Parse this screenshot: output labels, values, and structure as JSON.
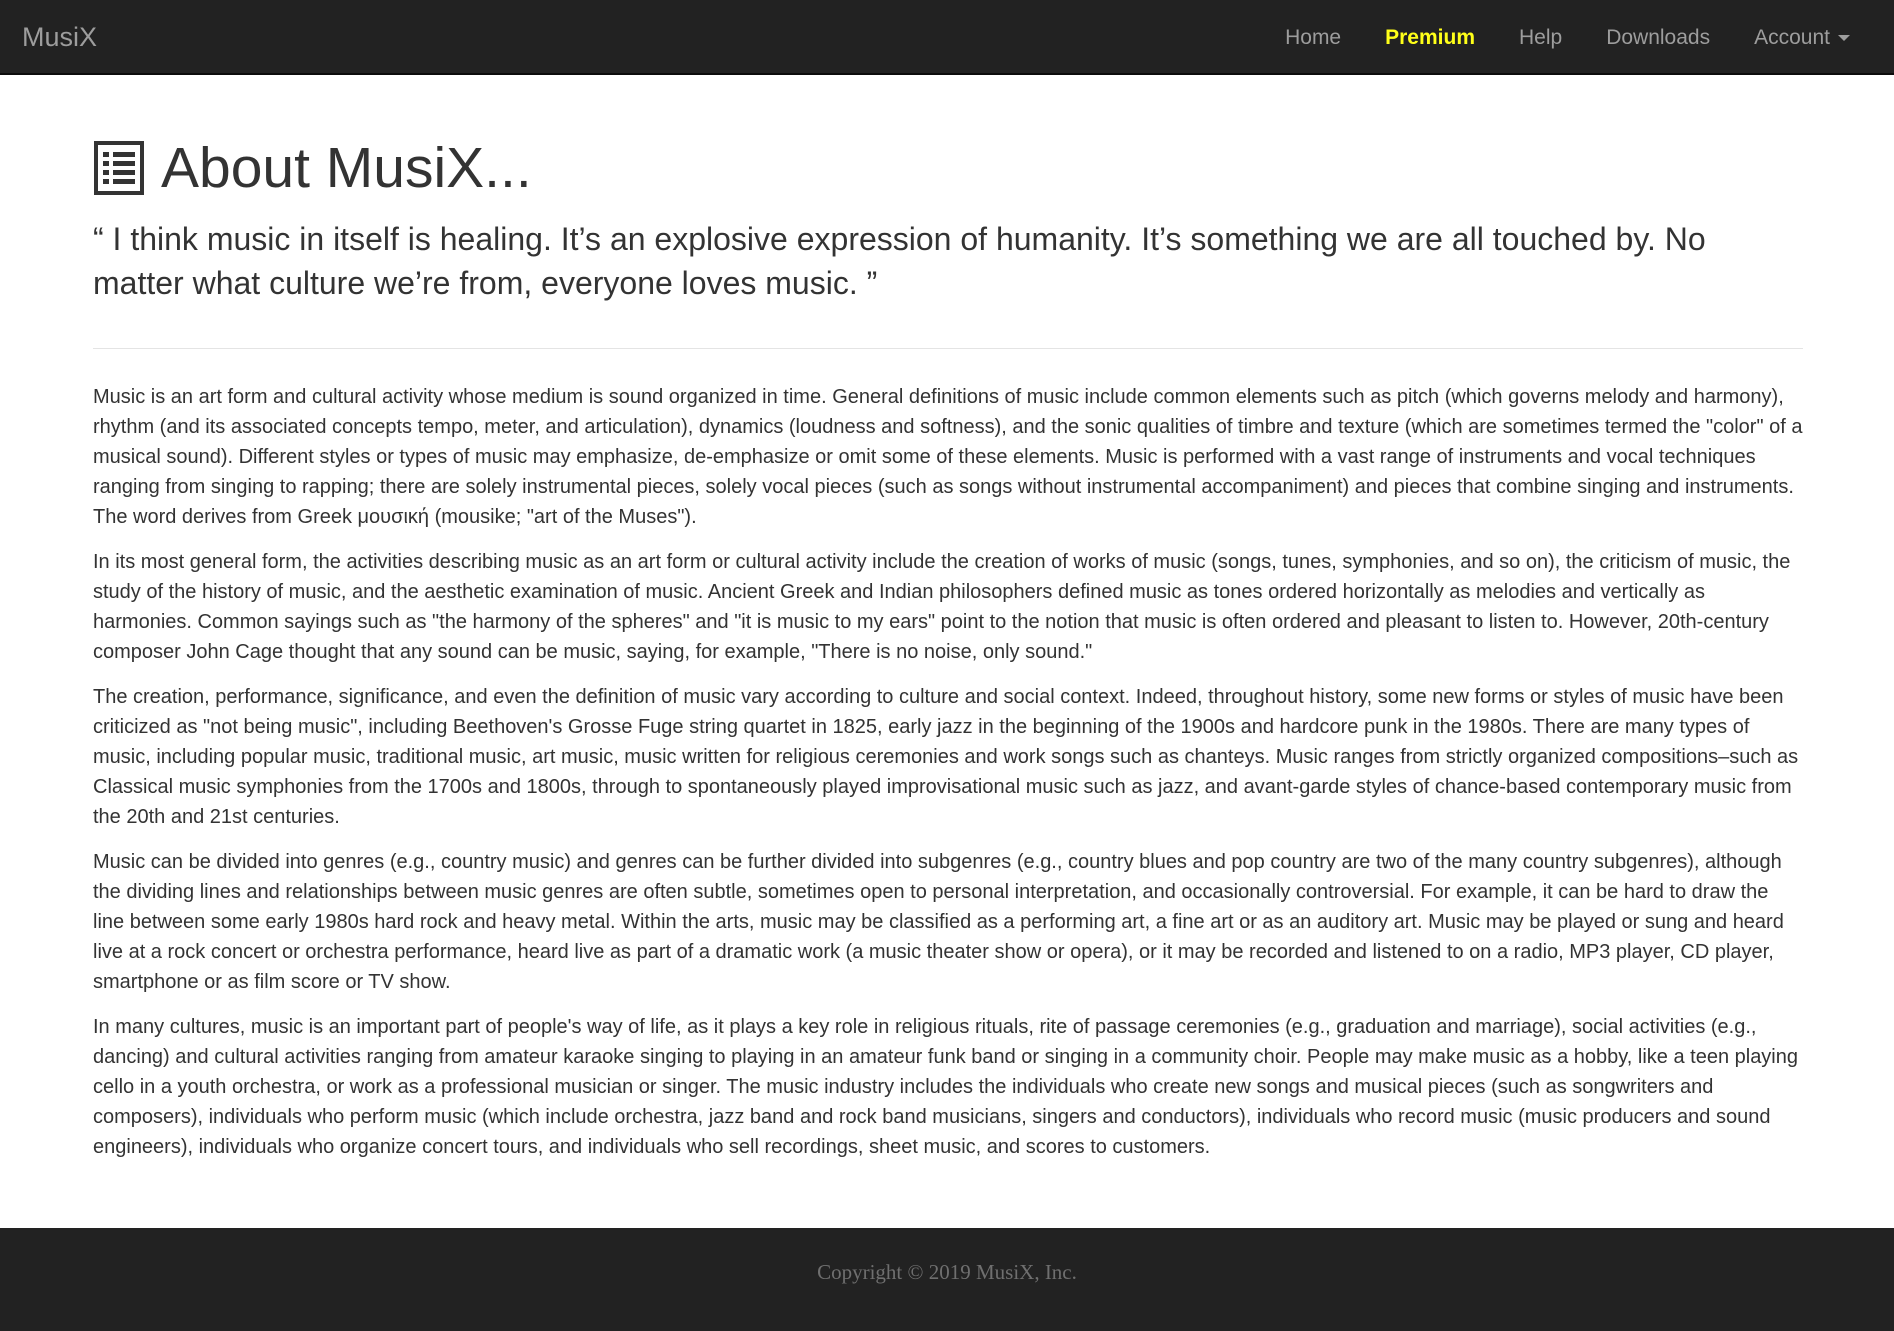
{
  "navbar": {
    "brand": "MusiX",
    "links": [
      {
        "label": "Home"
      },
      {
        "label": "Premium"
      },
      {
        "label": "Help"
      },
      {
        "label": "Downloads"
      },
      {
        "label": "Account"
      }
    ],
    "colors": {
      "background": "#222222",
      "link": "#9d9d9d",
      "premium": "#ffff19"
    }
  },
  "header": {
    "icon": "list-icon",
    "title": "About MusiX...",
    "quote": "“ I think music in itself is healing. It’s an explosive expression of humanity. It’s something we are all touched by. No matter what culture we’re from, everyone loves music. ”"
  },
  "content": {
    "paragraphs": [
      "Music is an art form and cultural activity whose medium is sound organized in time. General definitions of music include common elements such as pitch (which governs melody and harmony), rhythm (and its associated concepts tempo, meter, and articulation), dynamics (loudness and softness), and the sonic qualities of timbre and texture (which are sometimes termed the \"color\" of a musical sound). Different styles or types of music may emphasize, de-emphasize or omit some of these elements. Music is performed with a vast range of instruments and vocal techniques ranging from singing to rapping; there are solely instrumental pieces, solely vocal pieces (such as songs without instrumental accompaniment) and pieces that combine singing and instruments. The word derives from Greek μουσική (mousike; \"art of the Muses\").",
      "In its most general form, the activities describing music as an art form or cultural activity include the creation of works of music (songs, tunes, symphonies, and so on), the criticism of music, the study of the history of music, and the aesthetic examination of music. Ancient Greek and Indian philosophers defined music as tones ordered horizontally as melodies and vertically as harmonies. Common sayings such as \"the harmony of the spheres\" and \"it is music to my ears\" point to the notion that music is often ordered and pleasant to listen to. However, 20th-century composer John Cage thought that any sound can be music, saying, for example, \"There is no noise, only sound.\"",
      "The creation, performance, significance, and even the definition of music vary according to culture and social context. Indeed, throughout history, some new forms or styles of music have been criticized as \"not being music\", including Beethoven's Grosse Fuge string quartet in 1825, early jazz in the beginning of the 1900s and hardcore punk in the 1980s. There are many types of music, including popular music, traditional music, art music, music written for religious ceremonies and work songs such as chanteys. Music ranges from strictly organized compositions–such as Classical music symphonies from the 1700s and 1800s, through to spontaneously played improvisational music such as jazz, and avant-garde styles of chance-based contemporary music from the 20th and 21st centuries.",
      "Music can be divided into genres (e.g., country music) and genres can be further divided into subgenres (e.g., country blues and pop country are two of the many country subgenres), although the dividing lines and relationships between music genres are often subtle, sometimes open to personal interpretation, and occasionally controversial. For example, it can be hard to draw the line between some early 1980s hard rock and heavy metal. Within the arts, music may be classified as a performing art, a fine art or as an auditory art. Music may be played or sung and heard live at a rock concert or orchestra performance, heard live as part of a dramatic work (a music theater show or opera), or it may be recorded and listened to on a radio, MP3 player, CD player, smartphone or as film score or TV show.",
      "In many cultures, music is an important part of people's way of life, as it plays a key role in religious rituals, rite of passage ceremonies (e.g., graduation and marriage), social activities (e.g., dancing) and cultural activities ranging from amateur karaoke singing to playing in an amateur funk band or singing in a community choir. People may make music as a hobby, like a teen playing cello in a youth orchestra, or work as a professional musician or singer. The music industry includes the individuals who create new songs and musical pieces (such as songwriters and composers), individuals who perform music (which include orchestra, jazz band and rock band musicians, singers and conductors), individuals who record music (music producers and sound engineers), individuals who organize concert tours, and individuals who sell recordings, sheet music, and scores to customers."
    ]
  },
  "footer": {
    "copyright": "Copyright © 2019 MusiX, Inc."
  }
}
